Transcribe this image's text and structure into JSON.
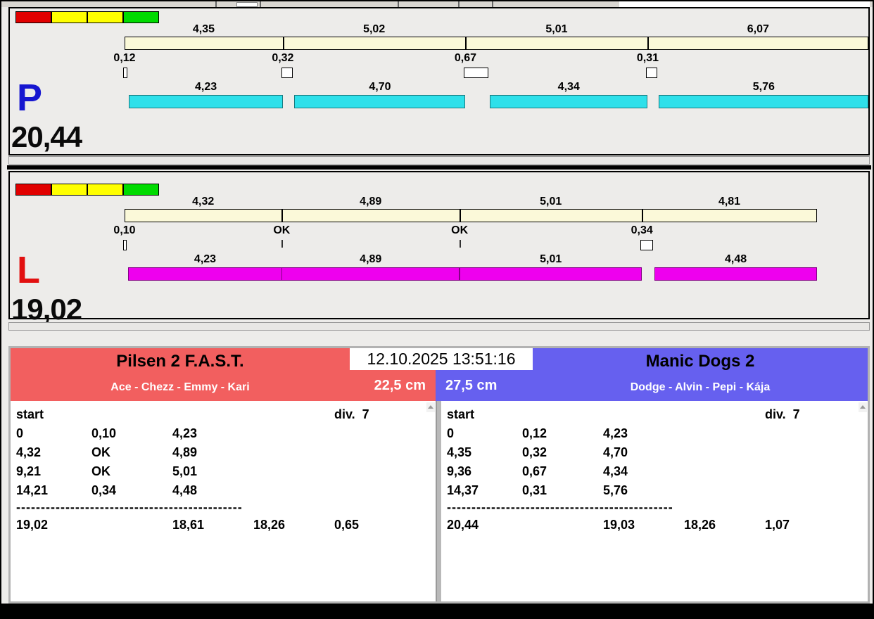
{
  "traffic_light_colors": [
    "#e10000",
    "#ffff00",
    "#ffff00",
    "#00db00"
  ],
  "lanes": [
    {
      "letter": "P",
      "letter_color": "#1616d0",
      "bar_color": "#2ee0ea",
      "total": "20,44",
      "segments": [
        {
          "leg": "4,35",
          "cross": "0,12",
          "dog": "4,23"
        },
        {
          "leg": "5,02",
          "cross": "0,32",
          "dog": "4,70"
        },
        {
          "leg": "5,01",
          "cross": "0,67",
          "dog": "4,34"
        },
        {
          "leg": "6,07",
          "cross": "0,31",
          "dog": "5,76"
        }
      ]
    },
    {
      "letter": "L",
      "letter_color": "#e21010",
      "bar_color": "#ee00ee",
      "total": "19,02",
      "segments": [
        {
          "leg": "4,32",
          "cross": "0,10",
          "dog": "4,23"
        },
        {
          "leg": "4,89",
          "cross": "OK",
          "dog": "4,89"
        },
        {
          "leg": "5,01",
          "cross": "OK",
          "dog": "5,01"
        },
        {
          "leg": "4,81",
          "cross": "0,34",
          "dog": "4,48"
        }
      ]
    }
  ],
  "scoreboard": {
    "timestamp": "12.10.2025 13:51:16",
    "left": {
      "team": "Pilsen 2 F.A.S.T.",
      "dogs": "Ace - Chezz - Emmy - Kari",
      "height": "22,5 cm",
      "header_color": "#f25f5f",
      "start_label": "start",
      "division": "div.  7",
      "rows": [
        [
          "0",
          "0,10",
          "4,23"
        ],
        [
          "4,32",
          "OK",
          "4,89"
        ],
        [
          "9,21",
          "OK",
          "5,01"
        ],
        [
          "14,21",
          "0,34",
          "4,48"
        ]
      ],
      "separator": "----------------------------------------------",
      "totals": [
        "19,02",
        "",
        "18,61",
        "18,26",
        "0,65"
      ]
    },
    "right": {
      "team": "Manic Dogs 2",
      "dogs": "Dodge - Alvin - Pepi - Kája",
      "height": "27,5 cm",
      "header_color": "#6660ef",
      "start_label": "start",
      "division": "div.  7",
      "rows": [
        [
          "0",
          "0,12",
          "4,23"
        ],
        [
          "4,35",
          "0,32",
          "4,70"
        ],
        [
          "9,36",
          "0,67",
          "4,34"
        ],
        [
          "14,37",
          "0,31",
          "5,76"
        ]
      ],
      "separator": "----------------------------------------------",
      "totals": [
        "20,44",
        "",
        "19,03",
        "18,26",
        "1,07"
      ]
    }
  }
}
